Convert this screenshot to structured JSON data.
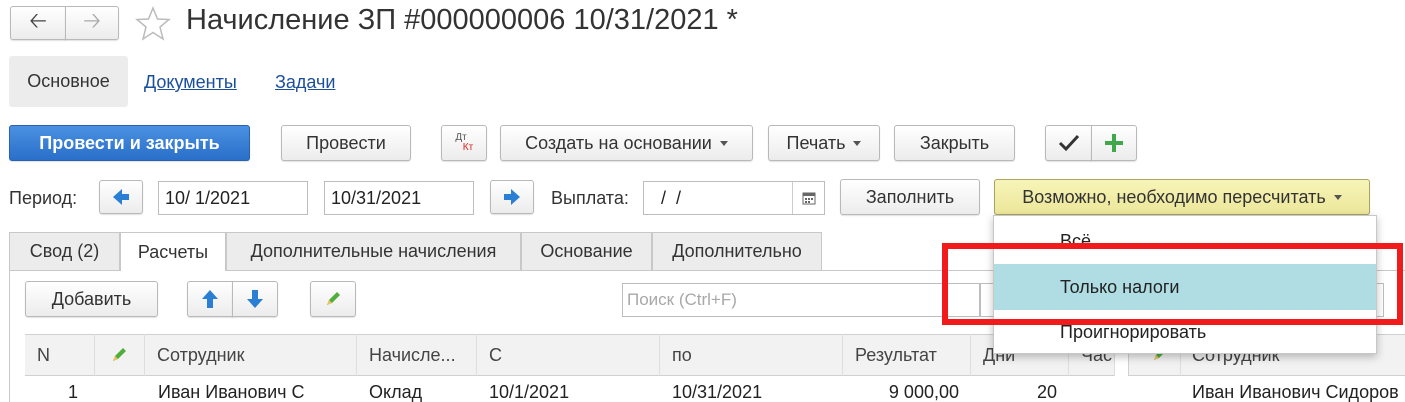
{
  "window": {
    "title": "Начисление ЗП #000000006 10/31/2021 *"
  },
  "sections": {
    "main": "Основное",
    "documents": "Документы",
    "tasks": "Задачи"
  },
  "toolbar": {
    "post_close": "Провести и закрыть",
    "post": "Провести",
    "dtkt_top": "Дт",
    "dtkt_bottom": "Кт",
    "create_based": "Создать на основании",
    "print": "Печать",
    "close": "Закрыть"
  },
  "period": {
    "label": "Период:",
    "start": "10/ 1/2021",
    "end": "10/31/2021",
    "payment_label": "Выплата:",
    "payment_value": " /  /",
    "fill_button": "Заполнить",
    "recalc_button": "Возможно, необходимо пересчитать"
  },
  "dropdown": {
    "options": [
      "Всё",
      "Только налоги",
      "Проигнорировать"
    ],
    "selected": "Только налоги"
  },
  "tabs": [
    "Свод (2)",
    "Расчеты",
    "Дополнительные начисления",
    "Основание",
    "Дополнительно"
  ],
  "grid_toolbar": {
    "add": "Добавить",
    "search_placeholder": "Поиск (Ctrl+F)"
  },
  "table": {
    "headers": [
      "N",
      "Сотрудник",
      "Начисле...",
      "С",
      "по",
      "Результат",
      "Дни",
      "Час"
    ],
    "rows": [
      {
        "n": "1",
        "employee": "Иван Иванович С",
        "accrual": "Оклад",
        "from": "10/1/2021",
        "to": "10/31/2021",
        "result": "9 000,00",
        "days": "20"
      }
    ]
  },
  "right_table": {
    "header": "Сотрудник",
    "row": "Иван Иванович Сидоров"
  },
  "colors": {
    "primary": "#2a6fc9",
    "highlight_border": "#f21b1b",
    "selected_item": "#afdde3",
    "warning_button": "#f3f0a0"
  }
}
